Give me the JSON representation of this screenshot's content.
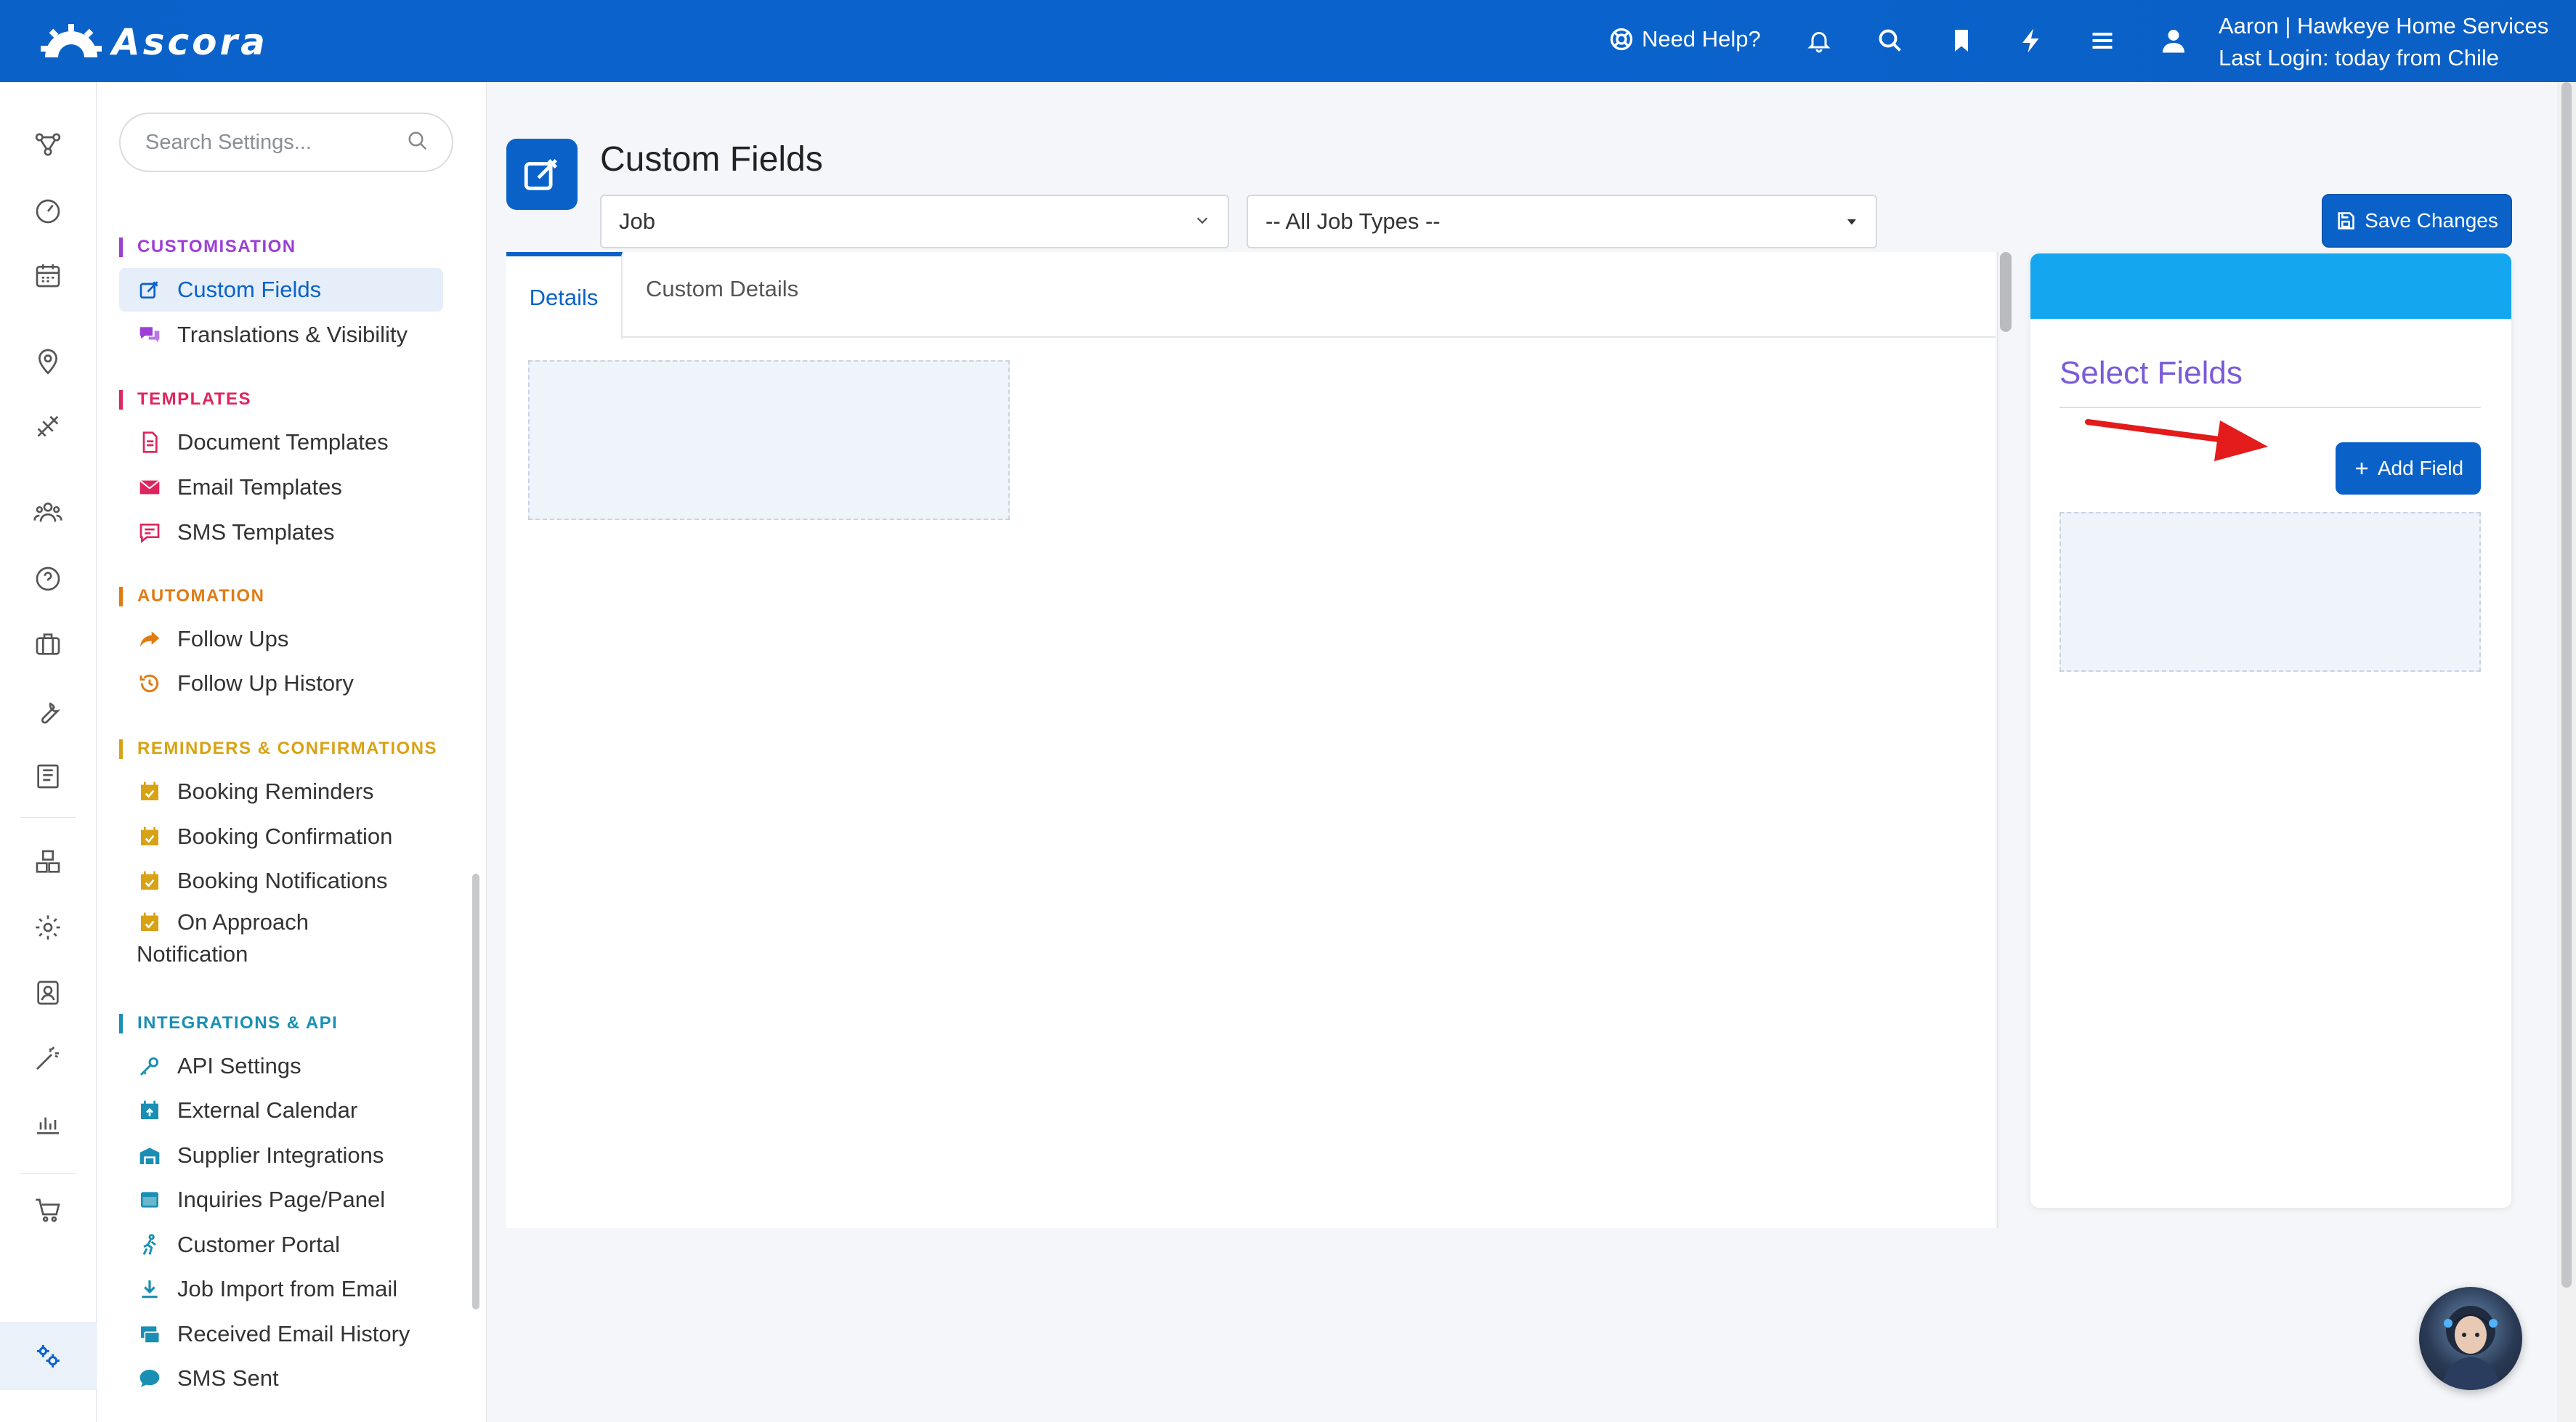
{
  "app": {
    "logo_text": "Ascora",
    "need_help": "Need Help?",
    "user_line1": "Aaron | Hawkeye Home Services",
    "user_line2": "Last Login: today from Chile"
  },
  "sidebar": {
    "search_placeholder": "Search Settings...",
    "sections": {
      "customisation": "CUSTOMISATION",
      "templates": "TEMPLATES",
      "automation": "AUTOMATION",
      "reminders": "REMINDERS & CONFIRMATIONS",
      "integrations": "INTEGRATIONS & API"
    },
    "items": {
      "custom_fields": "Custom Fields",
      "translations": "Translations & Visibility",
      "document_templates": "Document Templates",
      "email_templates": "Email Templates",
      "sms_templates": "SMS Templates",
      "follow_ups": "Follow Ups",
      "follow_up_history": "Follow Up History",
      "booking_reminders": "Booking Reminders",
      "booking_confirmation": "Booking Confirmation",
      "booking_notifications": "Booking Notifications",
      "on_approach_1": "On Approach",
      "on_approach_2": "Notification",
      "api_settings": "API Settings",
      "external_calendar": "External Calendar",
      "supplier_integrations": "Supplier Integrations",
      "inquiries_page": "Inquiries Page/Panel",
      "customer_portal": "Customer Portal",
      "job_import": "Job Import from Email",
      "received_email": "Received Email History",
      "sms_sent": "SMS Sent"
    }
  },
  "main": {
    "title": "Custom Fields",
    "entity_select": "Job",
    "job_type_select": "-- All Job Types --",
    "save_label": "Save Changes",
    "tabs": [
      "Details",
      "Custom Details"
    ],
    "select_fields_title": "Select Fields",
    "add_field_label": "Add Field"
  },
  "colors": {
    "primary": "#0a62c9",
    "customisation": "#9b3fd6",
    "templates": "#e0245e",
    "automation": "#e07b12",
    "reminders": "#d8a215",
    "integrations": "#1a8fb3",
    "card_header": "#14a7ef",
    "select_title": "#7a5bd8",
    "annotation_arrow": "#e31b1b"
  }
}
